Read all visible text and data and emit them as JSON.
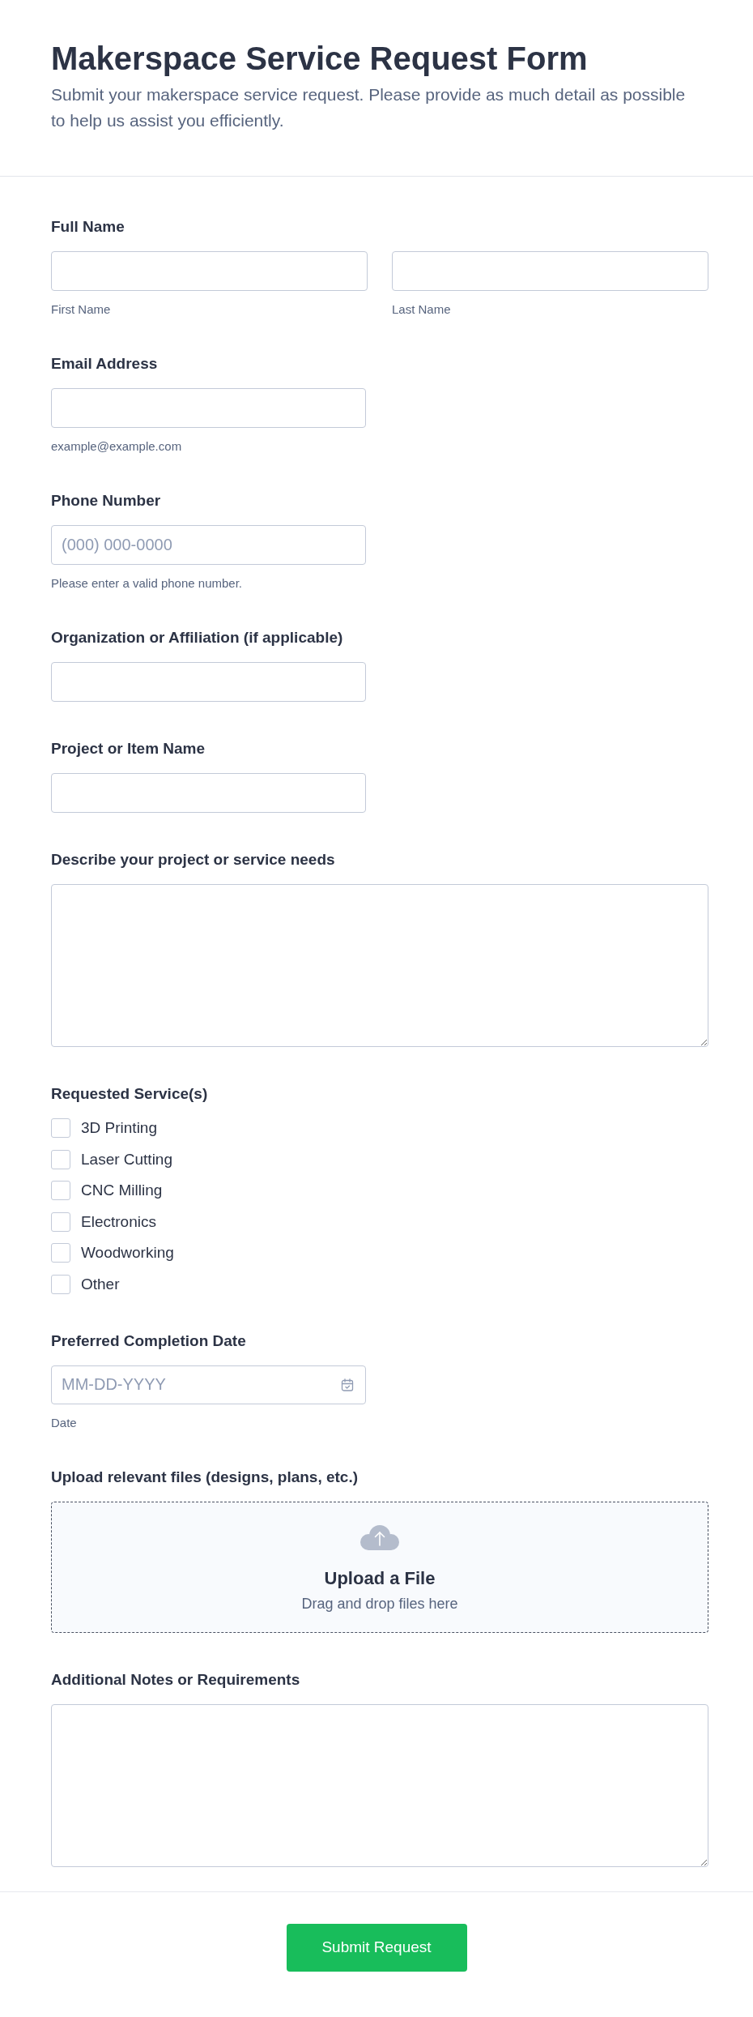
{
  "header": {
    "title": "Makerspace Service Request Form",
    "subtitle": "Submit your makerspace service request. Please provide as much detail as possible to help us assist you efficiently."
  },
  "fields": [
    {
      "kind": "name",
      "label": "Full Name",
      "inputs": [
        {
          "sublabel": "First Name"
        },
        {
          "sublabel": "Last Name"
        }
      ]
    },
    {
      "kind": "text",
      "label": "Email Address",
      "hint": "example@example.com"
    },
    {
      "kind": "text",
      "label": "Phone Number",
      "placeholder": "(000) 000-0000",
      "hint": "Please enter a valid phone number."
    },
    {
      "kind": "text",
      "label": "Organization or Affiliation (if applicable)"
    },
    {
      "kind": "text",
      "label": "Project or Item Name"
    },
    {
      "kind": "textarea",
      "label": "Describe your project or service needs"
    },
    {
      "kind": "checkboxes",
      "label": "Requested Service(s)",
      "options": [
        {
          "label": "3D Printing",
          "checked": false
        },
        {
          "label": "Laser Cutting",
          "checked": false
        },
        {
          "label": "CNC Milling",
          "checked": false
        },
        {
          "label": "Electronics",
          "checked": false
        },
        {
          "label": "Woodworking",
          "checked": false
        },
        {
          "label": "Other",
          "checked": false
        }
      ]
    },
    {
      "kind": "date",
      "label": "Preferred Completion Date",
      "placeholder": "MM-DD-YYYY",
      "hint": "Date"
    },
    {
      "kind": "upload",
      "label": "Upload relevant files (designs, plans, etc.)",
      "title": "Upload a File",
      "hint": "Drag and drop files here"
    },
    {
      "kind": "textarea",
      "label": "Additional Notes or Requirements"
    }
  ],
  "submit": {
    "label": "Submit Request"
  }
}
